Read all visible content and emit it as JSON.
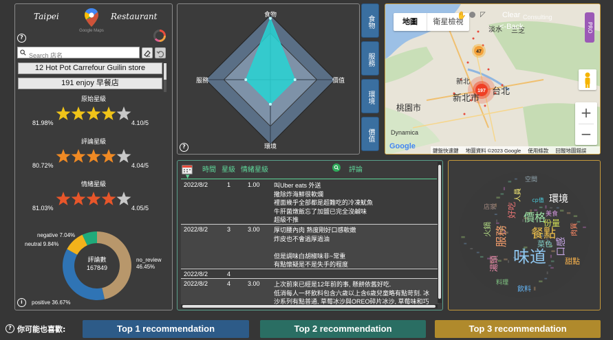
{
  "header": {
    "title_left": "Taipei",
    "title_right": "Restaurant",
    "logo_caption": "Google Maps"
  },
  "search": {
    "placeholder": "Search 店名",
    "value": ""
  },
  "stores": [
    "12 Hot Pot Carrefour Guilin store",
    "191 enjoy 早餐店"
  ],
  "ratings": [
    {
      "label": "原始星級",
      "percent": "81.98%",
      "score": "4.10/5",
      "stars_filled": 4,
      "star_color": "#f0c419"
    },
    {
      "label": "評論星級",
      "percent": "80.72%",
      "score": "4.04/5",
      "stars_filled": 4,
      "star_color": "#f08a24"
    },
    {
      "label": "情緒星級",
      "percent": "81.03%",
      "score": "4.05/5",
      "stars_filled": 4,
      "star_color": "#e8562a"
    }
  ],
  "donut": {
    "center_label": "評論數",
    "center_value": "167849",
    "segments": [
      {
        "name": "no_review",
        "percent": "46.45%",
        "value": 46.45,
        "color": "#b8976b"
      },
      {
        "name": "positive",
        "percent": "36.67%",
        "value": 36.67,
        "color": "#2f74b5"
      },
      {
        "name": "neutral",
        "percent": "9.84%",
        "value": 9.84,
        "color": "#f2b21b"
      },
      {
        "name": "negative",
        "percent": "7.04%",
        "value": 7.04,
        "color": "#1faa7a"
      }
    ],
    "labels": {
      "no_review": "no_review\n46.45%",
      "positive": "positive 36.67%",
      "neutral": "neutral 9.84%",
      "negative": "negative 7.04%"
    }
  },
  "radar": {
    "axes": [
      "食物",
      "價值",
      "環境",
      "服務"
    ],
    "outer": [
      1.0,
      1.0,
      1.0,
      1.0
    ],
    "inner": [
      0.72,
      0.72,
      0.72,
      0.72
    ],
    "value": [
      0.95,
      0.38,
      0.38,
      0.38
    ],
    "value_color": "#27d3d3"
  },
  "radar_tabs": [
    "食物",
    "服務",
    "環境",
    "價值"
  ],
  "map": {
    "btn_map": "地圖",
    "btn_satellite": "衛星檢視",
    "clear": "Clear",
    "back": "<-Back",
    "consulting": "Consulting",
    "pro": "PRO",
    "cluster_small": "47",
    "cluster_big": "197",
    "places": [
      "淡水",
      "三芝",
      "新北",
      "新北市",
      "台北",
      "桃園市",
      "Dynamica"
    ],
    "footer": [
      "鍵盤快速鍵",
      "地圖資料 ©2023 Google",
      "使用條款",
      "回報地圖錯誤"
    ],
    "zoom_in": "+",
    "zoom_out": "−",
    "google": "Google"
  },
  "reviews": {
    "headers": {
      "time": "時間",
      "star": "星級",
      "emotion": "情緒星級",
      "comment": "評論"
    },
    "rows": [
      {
        "date": "2022/8/2",
        "star": "1",
        "emo": "1.00",
        "text": "叫Uber eats 外送\n撒除炸海鮮很軟爛\n裡面幾乎全部都是超難吃的冷凍魷魚\n牛肝菌燉飯忘了加鹽已完全沒鹹味\n超級不推"
      },
      {
        "date": "2022/8/2",
        "star": "3",
        "emo": "3.00",
        "text": "厚切腰內肉 熟度剛好口感軟嫩\n炸皮也不會過厚過油\n\n但是調味白胡椒味非~常重\n有點懷疑是不是失手的程度"
      },
      {
        "date": "2022/8/2",
        "star": "4",
        "emo": "",
        "text": ""
      },
      {
        "date": "2022/8/2",
        "star": "4",
        "emo": "3.00",
        "text": "上次前來已經是12年前的事, 懸餅依舊好吃.\n低消每人一杯飲料包含六歲以上含6歲兒童略有點苛刻. 冰\n沙系列有點普通, 草莓冰沙與OREO碎片冰沙, 草莓味和巧"
      }
    ]
  },
  "wordcloud": {
    "words": [
      {
        "t": "味道",
        "c": "#8fc7f0"
      },
      {
        "t": "餐點",
        "c": "#f0c14b"
      },
      {
        "t": "價格",
        "c": "#9be0a4"
      },
      {
        "t": "環境",
        "c": "#ffffff"
      },
      {
        "t": "口感",
        "c": "#c9a8e8"
      },
      {
        "t": "服務",
        "c": "#f39c6b"
      },
      {
        "t": "份量",
        "c": "#d4e157"
      },
      {
        "t": "好吃",
        "c": "#e57373"
      },
      {
        "t": "菜色",
        "c": "#80cbc4"
      },
      {
        "t": "湯頭",
        "c": "#f48fb1"
      },
      {
        "t": "火鍋",
        "c": "#aed581"
      },
      {
        "t": "甜點",
        "c": "#ffb74d"
      },
      {
        "t": "飲料",
        "c": "#64b5f6"
      },
      {
        "t": "美食",
        "c": "#ce93d8"
      },
      {
        "t": "人員",
        "c": "#fff176"
      },
      {
        "t": "cp值",
        "c": "#4dd0e1"
      },
      {
        "t": "肉質",
        "c": "#ff8a65"
      },
      {
        "t": "店家",
        "c": "#a1887f"
      },
      {
        "t": "空間",
        "c": "#90a4ae"
      },
      {
        "t": "料理",
        "c": "#81c784"
      }
    ]
  },
  "bottom": {
    "question": "你可能也喜歡:",
    "recs": [
      {
        "label": "Top 1 recommendation",
        "color": "#2d5b88"
      },
      {
        "label": "Top 2 recommendation",
        "color": "#2a6e63"
      },
      {
        "label": "Top 3 recommendation",
        "color": "#b08a2c"
      }
    ]
  }
}
